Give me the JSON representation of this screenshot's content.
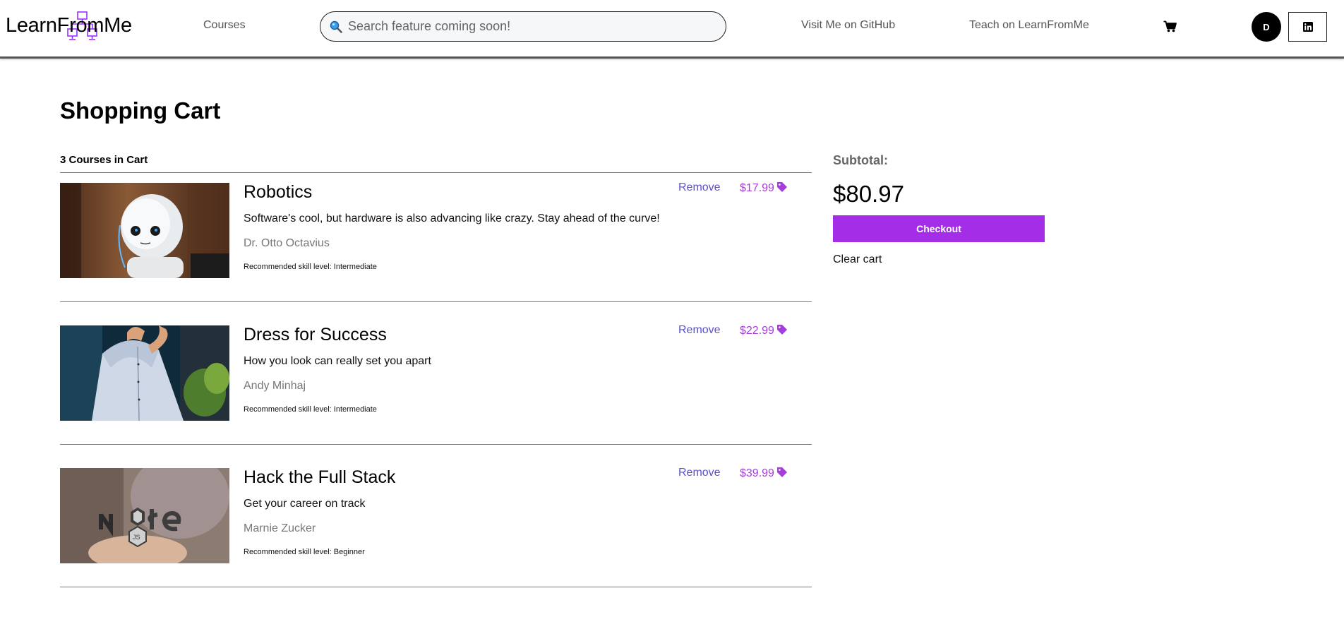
{
  "header": {
    "logo_text": "LearnFromMe",
    "nav_courses": "Courses",
    "search_placeholder": "Search feature coming soon!",
    "nav_github": "Visit Me on GitHub",
    "nav_teach": "Teach on LearnFromMe",
    "avatar_initial": "D",
    "icons": [
      "logo-network-icon",
      "search-icon",
      "cart-icon",
      "linkedin-icon"
    ]
  },
  "cart": {
    "title": "Shopping Cart",
    "count_label": "3 Courses in Cart",
    "remove_label": "Remove",
    "items": [
      {
        "title": "Robotics",
        "description": "Software's cool, but hardware is also advancing like crazy. Stay ahead of the curve!",
        "author": "Dr. Otto Octavius",
        "level": "Recommended skill level: Intermediate",
        "price": "$17.99"
      },
      {
        "title": "Dress for Success",
        "description": "How you look can really set you apart",
        "author": "Andy Minhaj",
        "level": "Recommended skill level: Intermediate",
        "price": "$22.99"
      },
      {
        "title": "Hack the Full Stack",
        "description": "Get your career on track",
        "author": "Marnie Zucker",
        "level": "Recommended skill level: Beginner",
        "price": "$39.99"
      }
    ]
  },
  "summary": {
    "subtotal_label": "Subtotal:",
    "subtotal_value": "$80.97",
    "checkout_label": "Checkout",
    "clear_label": "Clear cart"
  },
  "colors": {
    "accent_purple": "#a42ee8",
    "remove_link": "#5b4fcf",
    "price": "#a43ddc"
  }
}
